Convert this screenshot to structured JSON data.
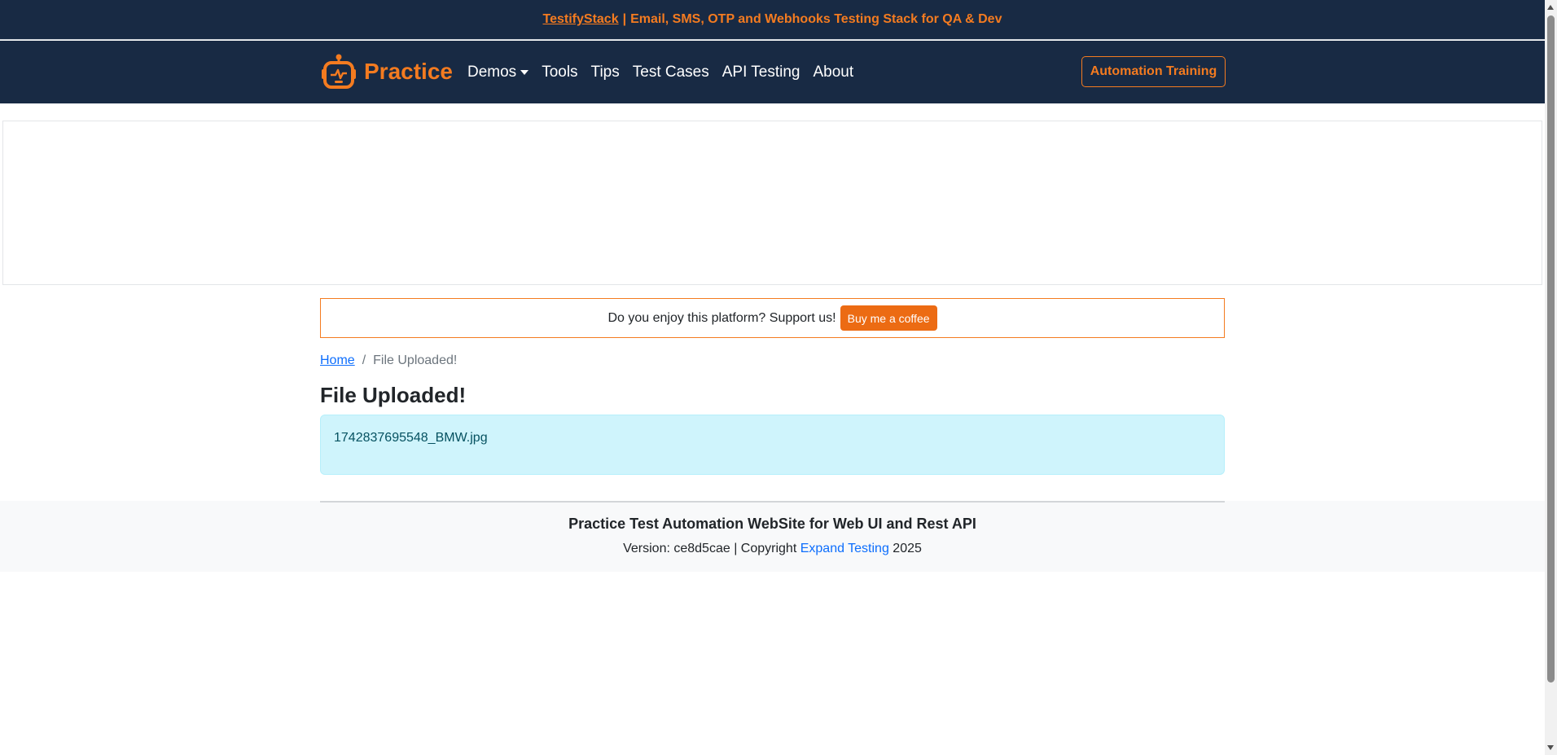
{
  "banner": {
    "link_text": "TestifyStack",
    "separator": "|",
    "text": "Email, SMS, OTP and Webhooks Testing Stack for QA & Dev"
  },
  "nav": {
    "brand": "Practice",
    "logo_icon": "robot-icon",
    "items": [
      {
        "label": "Demos",
        "has_dropdown": true
      },
      {
        "label": "Tools"
      },
      {
        "label": "Tips"
      },
      {
        "label": "Test Cases"
      },
      {
        "label": "API Testing"
      },
      {
        "label": "About"
      }
    ],
    "cta": "Automation Training"
  },
  "support": {
    "text": "Do you enjoy this platform? Support us!",
    "button": "Buy me a coffee"
  },
  "breadcrumb": {
    "home": "Home",
    "divider": "/",
    "current": "File Uploaded!"
  },
  "page": {
    "title": "File Uploaded!",
    "uploaded_file": "1742837695548_BMW.jpg"
  },
  "footer": {
    "title": "Practice Test Automation WebSite for Web UI and Rest API",
    "version_prefix": "Version: ce8d5cae | Copyright",
    "company": "Expand Testing",
    "year": "2025"
  },
  "colors": {
    "navbar_bg": "#182a44",
    "accent": "#f47b20",
    "link": "#0d6efd",
    "alert_bg": "#cff4fc",
    "alert_text": "#055160"
  }
}
